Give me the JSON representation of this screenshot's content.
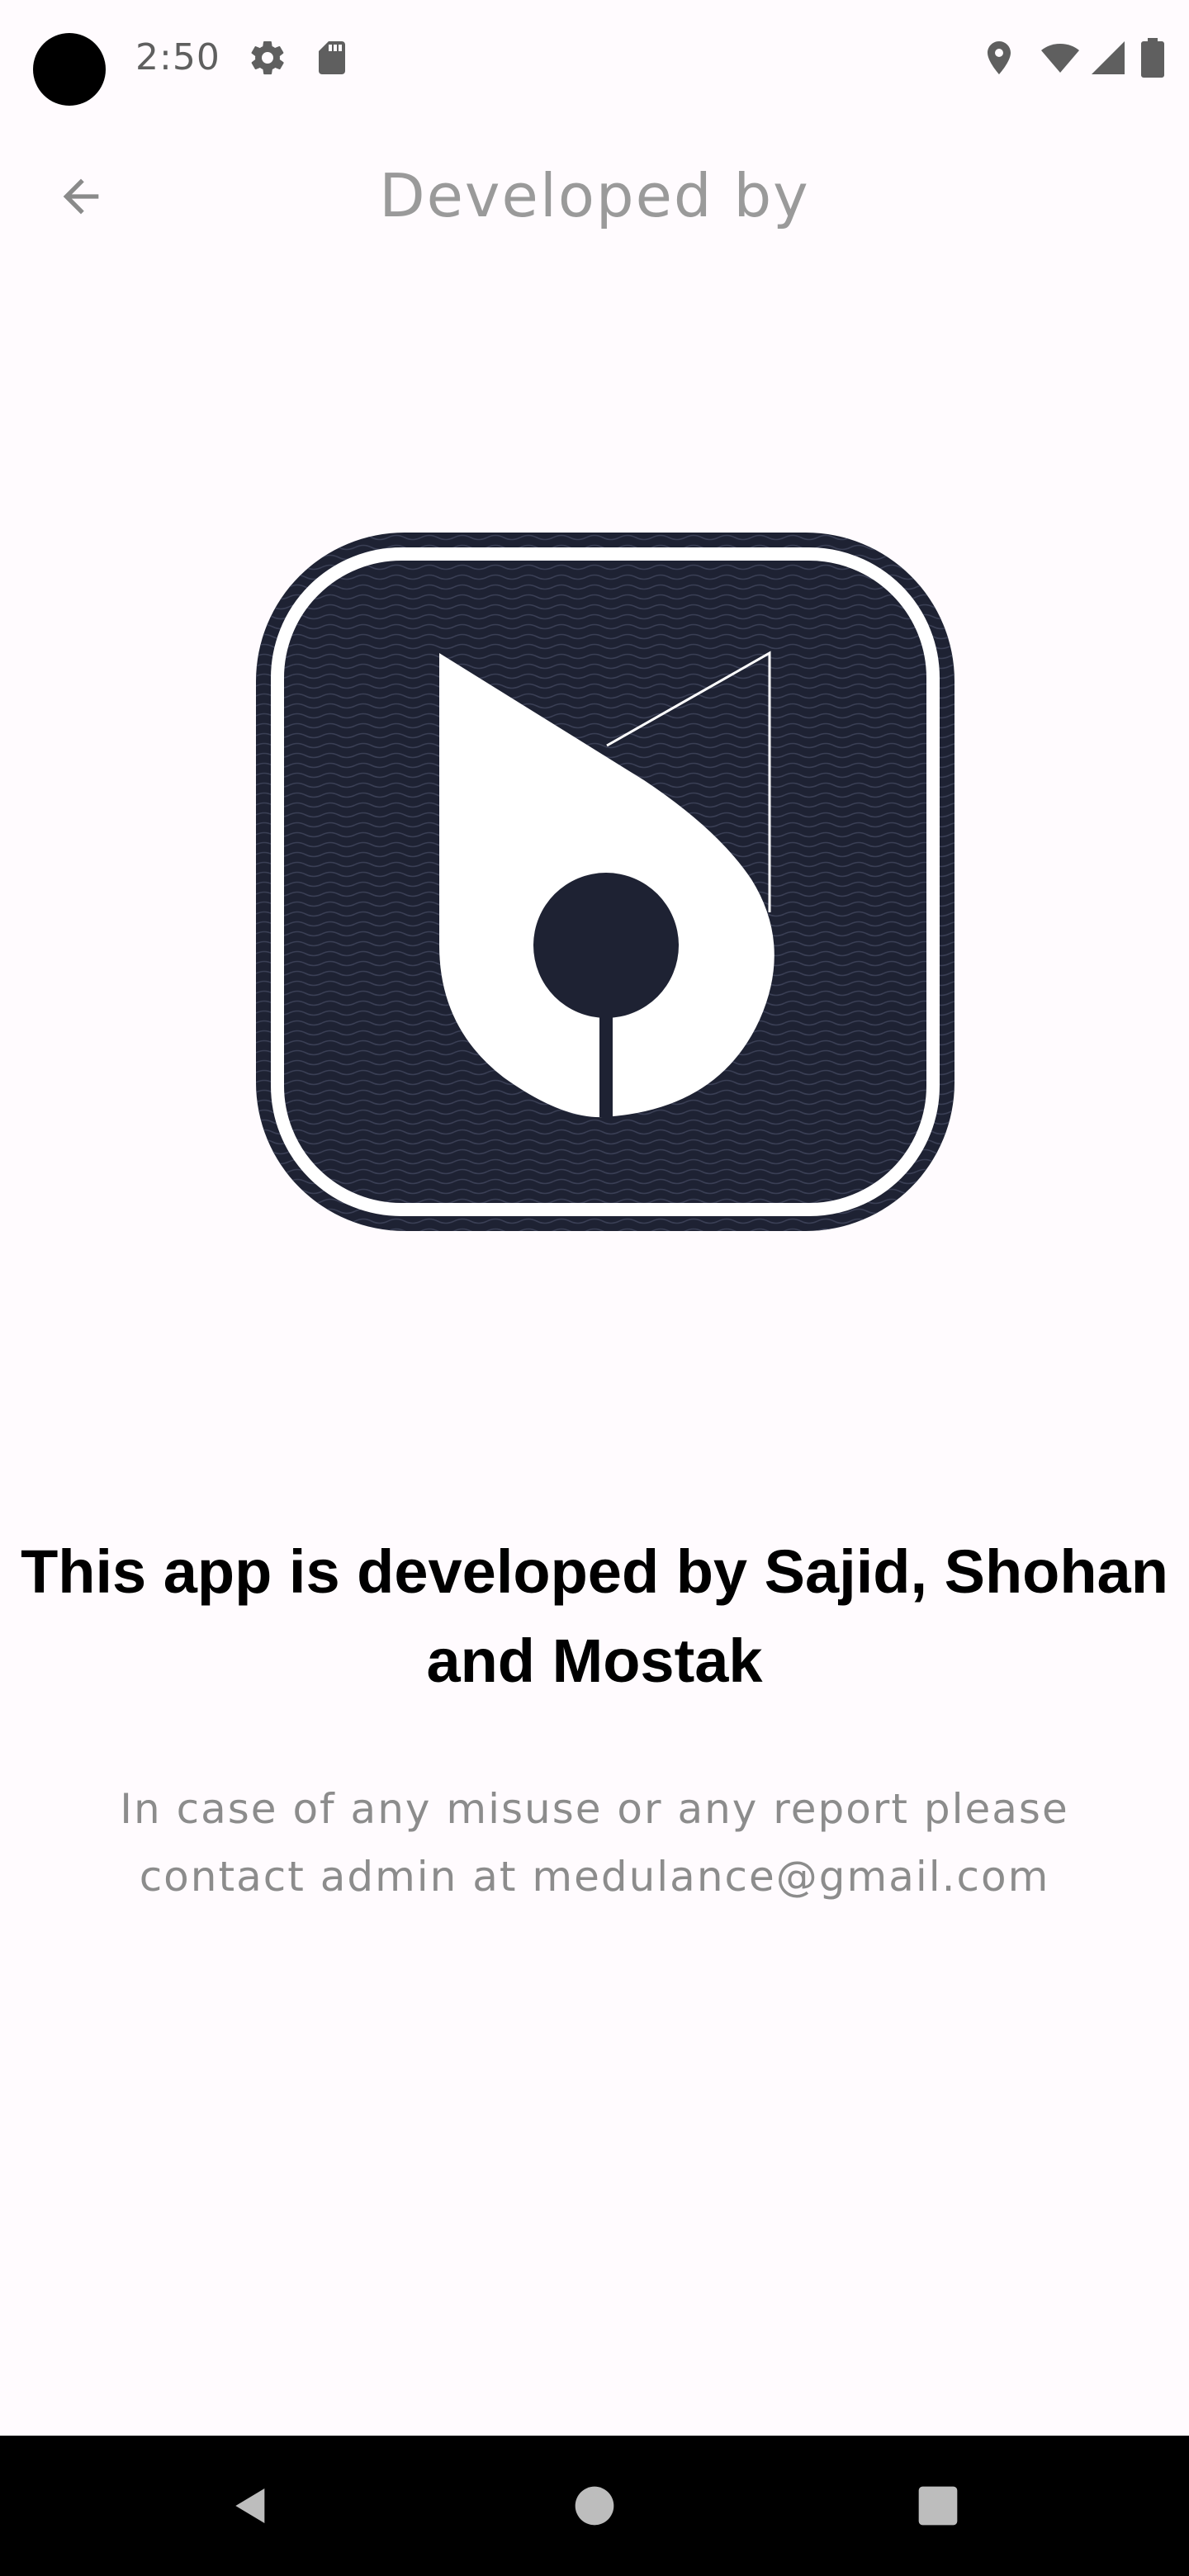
{
  "status_bar": {
    "time": "2:50",
    "left_icons": [
      "settings-icon",
      "sd-card-icon"
    ],
    "right_icons": [
      "location-icon",
      "wifi-icon",
      "signal-icon",
      "battery-icon"
    ]
  },
  "app_bar": {
    "title": "Developed by",
    "back_icon": "arrow-back-icon"
  },
  "logo": {
    "background_color": "#1e2233",
    "foreground_color": "#ffffff"
  },
  "content": {
    "headline": "This app is developed by Sajid, Shohan and Mostak",
    "subtext": "In case of any misuse or any report please contact admin at medulance@gmail.com"
  },
  "nav_bar": {
    "buttons": [
      "back-triangle-icon",
      "home-circle-icon",
      "recents-square-icon"
    ]
  }
}
